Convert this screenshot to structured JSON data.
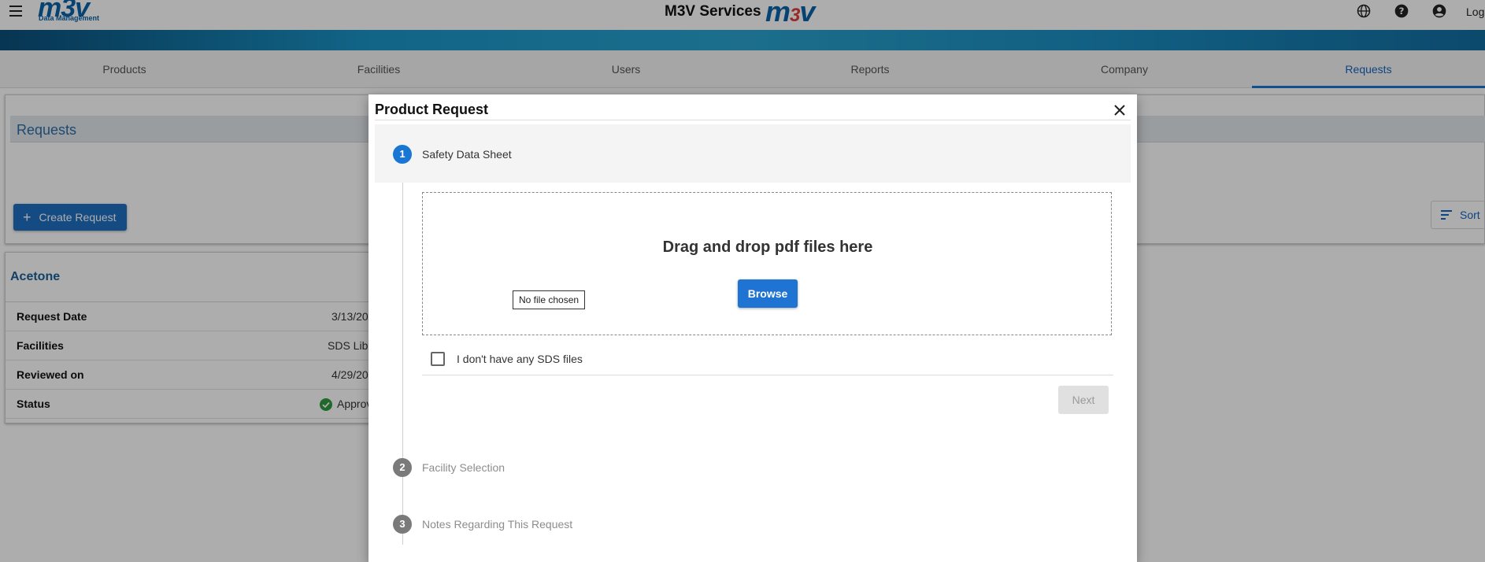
{
  "header": {
    "app_title": "M3V Services",
    "logo_left_word": "m3v",
    "logo_left_sub": "Data Management",
    "logo_center_prefix": "m",
    "logo_center_three": "3",
    "logo_center_suffix": "v",
    "login_label": "Log",
    "icons": [
      "menu-icon",
      "globe-icon",
      "help-icon",
      "account-icon"
    ]
  },
  "nav": {
    "tabs": [
      {
        "label": "Products"
      },
      {
        "label": "Facilities"
      },
      {
        "label": "Users"
      },
      {
        "label": "Reports"
      },
      {
        "label": "Company"
      },
      {
        "label": "Requests",
        "active": true
      }
    ]
  },
  "requests": {
    "title": "Requests",
    "create_button": "Create Request",
    "sort_button": "Sort"
  },
  "request_card": {
    "title": "Acetone",
    "rows": [
      {
        "key": "Request Date",
        "value": "3/13/20"
      },
      {
        "key": "Facilities",
        "value": "SDS Libr"
      },
      {
        "key": "Reviewed on",
        "value": "4/29/20"
      },
      {
        "key": "Status",
        "value": "Approv"
      }
    ]
  },
  "modal": {
    "title": "Product Request",
    "steps": [
      {
        "number": "1",
        "label": "Safety Data Sheet",
        "active": true
      },
      {
        "number": "2",
        "label": "Facility Selection",
        "active": false
      },
      {
        "number": "3",
        "label": "Notes Regarding This Request",
        "active": false
      }
    ],
    "dropzone_text": "Drag and drop pdf files here",
    "file_input_text": "No file chosen",
    "browse_button": "Browse",
    "no_sds_checkbox_label": "I don't have any SDS files",
    "no_sds_checked": false,
    "next_button": "Next"
  },
  "colors": {
    "primary": "#1976d2",
    "brand": "#0b63a8",
    "status_approved": "#2e9b3e"
  }
}
